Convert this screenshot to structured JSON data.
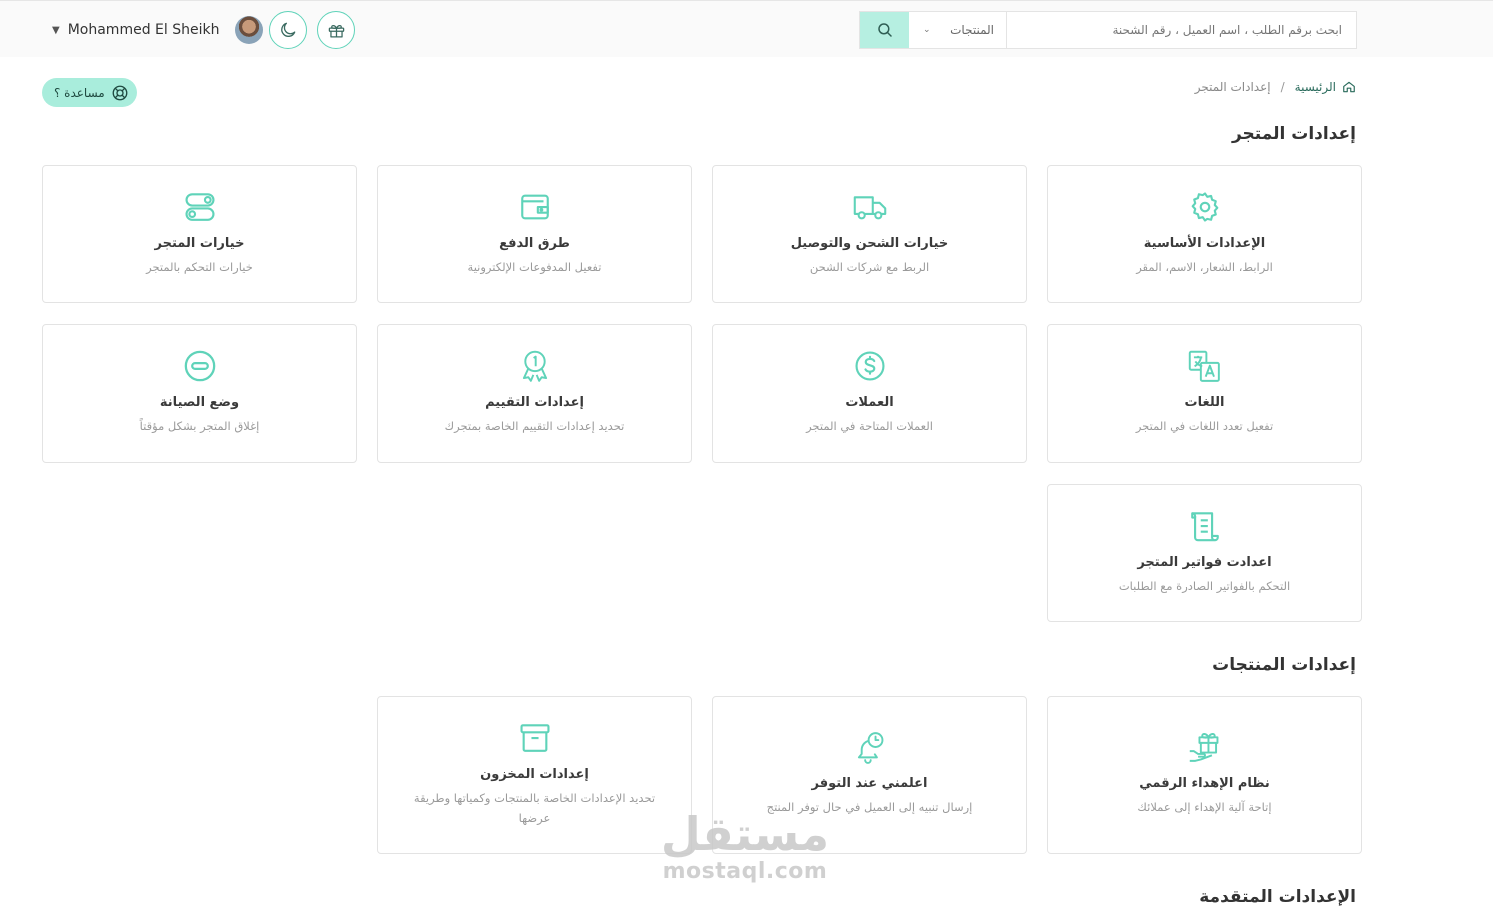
{
  "header": {
    "user_name": "Mohammed El Sheikh",
    "search": {
      "placeholder": "ابحث برقم الطلب ، اسم العميل ، رقم الشحنة",
      "scope": "المنتجات"
    }
  },
  "breadcrumb": {
    "home": "الرئيسية",
    "separator": "/",
    "current": "إعدادات المتجر"
  },
  "help_label": "مساعدة ؟",
  "sections": {
    "store": {
      "title": "إعدادات المتجر",
      "cards": [
        {
          "icon": "gear-icon",
          "title": "الإعدادات الأساسية",
          "desc": "الرابط، الشعار، الاسم، المقر"
        },
        {
          "icon": "truck-icon",
          "title": "خيارات الشحن والتوصيل",
          "desc": "الربط مع شركات الشحن"
        },
        {
          "icon": "wallet-icon",
          "title": "طرق الدفع",
          "desc": "تفعيل المدفوعات الإلكترونية"
        },
        {
          "icon": "toggles-icon",
          "title": "خيارات المتجر",
          "desc": "خيارات التحكم بالمتجر"
        },
        {
          "icon": "translate-icon",
          "title": "اللغات",
          "desc": "تفعيل تعدد اللغات في المتجر"
        },
        {
          "icon": "dollar-icon",
          "title": "العملات",
          "desc": "العملات المتاحة في المتجر"
        },
        {
          "icon": "award-icon",
          "title": "إعدادات التقييم",
          "desc": "تحديد إعدادات التقييم الخاصة بمتجرك"
        },
        {
          "icon": "minus-circle-icon",
          "title": "وضع الصيانة",
          "desc": "إغلاق المتجر بشكل مؤقتاً"
        },
        {
          "icon": "receipt-icon",
          "title": "اعدادت فواتير المتجر",
          "desc": "التحكم بالفواتير الصادرة مع الطلبات"
        }
      ]
    },
    "products": {
      "title": "إعدادات المنتجات",
      "cards": [
        {
          "icon": "gift-hand-icon",
          "title": "نظام الإهداء الرقمي",
          "desc": "إتاحة آلية الإهداء إلى عملائك"
        },
        {
          "icon": "bell-clock-icon",
          "title": "اعلمني عند التوفر",
          "desc": "إرسال تنبيه إلى العميل في حال توفر المنتج"
        },
        {
          "icon": "archive-icon",
          "title": "إعدادات المخزون",
          "desc": "تحديد الإعدادات الخاصة بالمنتجات وكمياتها وطريقة عرضها"
        }
      ]
    },
    "advanced": {
      "title": "الإعدادات المتقدمة"
    }
  },
  "watermark": {
    "arabic": "مستقل",
    "latin": "mostaql.com"
  },
  "colors": {
    "accent": "#5fd3b9",
    "accent_light": "#b6efe1",
    "help_bg": "#a9eddc"
  }
}
